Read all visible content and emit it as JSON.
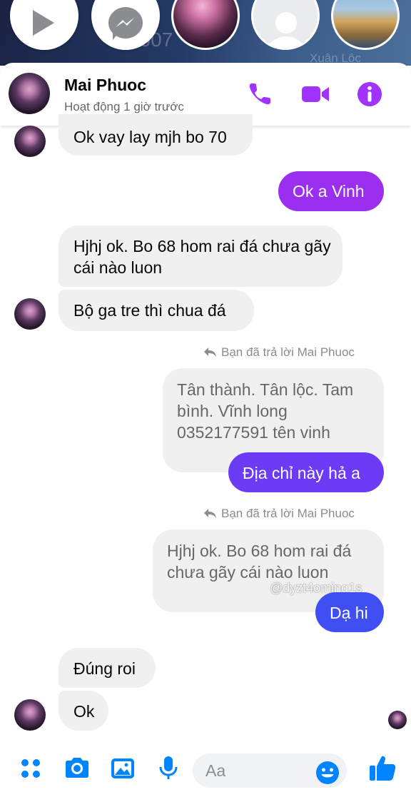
{
  "header": {
    "contact_name": "Mai Phuoc",
    "status": "Hoạt động 1 giờ trước"
  },
  "story_strip": {
    "faint_text_left": "2007",
    "faint_text_right": "Xuân Lộc"
  },
  "messages": {
    "m1": "Ok vay lay mjh bo 70",
    "m2": "Ok a Vinh",
    "m3": "Hjhj ok. Bo 68 hom rai đá chưa gãy cái nào luon",
    "m4": "Bộ ga tre thì chua đá",
    "reply1_note": "Bạn đã trả lời Mai Phuoc",
    "reply1_quote": "Tân thành. Tân lộc. Tam bình. Vĩnh long 0352177591 tên vinh",
    "m5": "Địa chỉ này hả a",
    "reply2_note": "Bạn đã trả lời Mai Phuoc",
    "reply2_quote": "Hjhj ok. Bo 68 hom rai đá chưa gãy cái nào luon",
    "m6": "Dạ hi",
    "m7": "Đúng roi",
    "m8": "Ok"
  },
  "watermark": "@dyzt4oming1s",
  "composer": {
    "placeholder": "Aa"
  },
  "colors": {
    "accent": "#a033ff",
    "bubble_in": "#f0f0f0",
    "bubble_out_purple": "#9b2ff0",
    "bubble_out_violet": "#6b3bf5",
    "bubble_out_blue": "#3f4ff2",
    "composer_icons": "#0084ff",
    "secondary_text": "#65676b"
  },
  "icons": [
    "play-icon",
    "messenger-icon",
    "phone-icon",
    "video-camera-icon",
    "info-icon",
    "reply-arrow-icon",
    "apps-grid-icon",
    "camera-icon",
    "gallery-icon",
    "microphone-icon",
    "emoji-icon",
    "thumbs-up-icon"
  ]
}
